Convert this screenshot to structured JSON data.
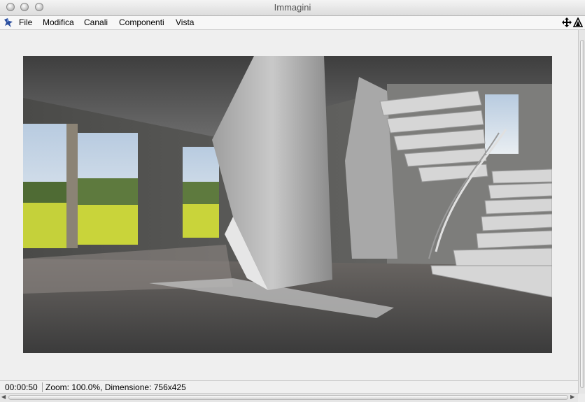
{
  "window": {
    "title": "Immagini"
  },
  "menu": {
    "items": [
      "File",
      "Modifica",
      "Canali",
      "Componenti",
      "Vista"
    ]
  },
  "image": {
    "description_icon": "rendered-interior-image"
  },
  "status": {
    "time": "00:00:50",
    "info": "Zoom: 100.0%, Dimensione: 756x425"
  },
  "icons": {
    "app": "app-logo-icon",
    "move": "move-arrows-icon",
    "warning": "warning-triangle-icon"
  }
}
